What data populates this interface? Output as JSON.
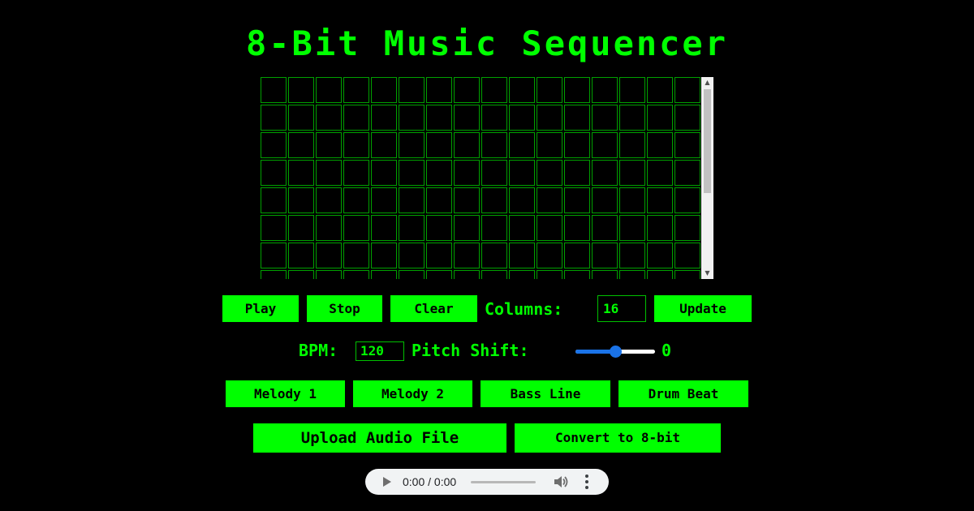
{
  "app": {
    "title": "8-Bit Music Sequencer",
    "accent_color": "#00ff00",
    "background_color": "#000000"
  },
  "sequencer": {
    "columns_visible": 16,
    "rows_visible": 8
  },
  "controls": {
    "play_label": "Play",
    "stop_label": "Stop",
    "clear_label": "Clear",
    "columns_label": "Columns:",
    "columns_value": "16",
    "update_label": "Update",
    "bpm_label": "BPM:",
    "bpm_value": "120",
    "pitch_label": "Pitch Shift:",
    "pitch_value": "0",
    "pitch_fraction": 0.5
  },
  "presets": {
    "melody1_label": "Melody 1",
    "melody2_label": "Melody 2",
    "bass_label": "Bass Line",
    "drum_label": "Drum Beat"
  },
  "audio_tools": {
    "upload_label": "Upload Audio File",
    "convert_label": "Convert to 8-bit"
  },
  "player": {
    "time": "0:00 / 0:00",
    "play_icon": "play-icon",
    "volume_icon": "volume-icon",
    "more_icon": "more-options-icon"
  }
}
